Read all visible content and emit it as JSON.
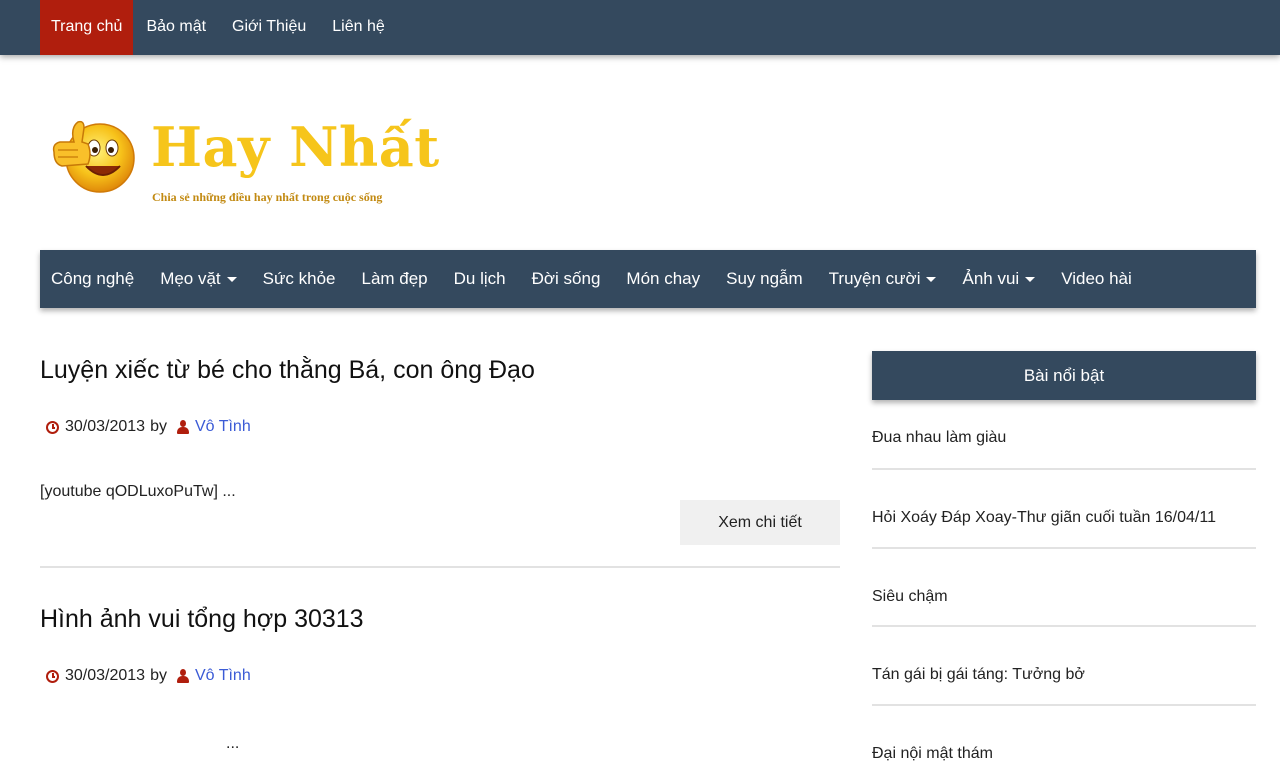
{
  "topnav": {
    "items": [
      "Trang chủ",
      "Bảo mật",
      "Giới Thiệu",
      "Liên hệ"
    ],
    "active_index": 0
  },
  "logo": {
    "title": "Hay Nhất",
    "tagline": "Chia sẻ những điều hay nhất trong cuộc sống",
    "icon": "thumbs-up-smiley-icon"
  },
  "mainnav": {
    "items": [
      {
        "label": "Công nghệ",
        "dropdown": false
      },
      {
        "label": "Mẹo vặt",
        "dropdown": true
      },
      {
        "label": "Sức khỏe",
        "dropdown": false
      },
      {
        "label": "Làm đẹp",
        "dropdown": false
      },
      {
        "label": "Du lịch",
        "dropdown": false
      },
      {
        "label": "Đời sống",
        "dropdown": false
      },
      {
        "label": "Món chay",
        "dropdown": false
      },
      {
        "label": "Suy ngẫm",
        "dropdown": false
      },
      {
        "label": "Truyện cười",
        "dropdown": true
      },
      {
        "label": "Ảnh vui",
        "dropdown": true
      },
      {
        "label": "Video hài",
        "dropdown": false
      }
    ]
  },
  "posts": [
    {
      "title": "Luyện xiếc từ bé cho thằng Bá, con ông Đạo",
      "date": "30/03/2013",
      "by": "by",
      "author": "Vô Tình",
      "excerpt": "[youtube qODLuxoPuTw] ...",
      "readmore": "Xem chi tiết"
    },
    {
      "title": "Hình ảnh vui tổng hợp 30313",
      "date": "30/03/2013",
      "by": "by",
      "author": "Vô Tình",
      "excerpt": "..."
    }
  ],
  "sidebar": {
    "title": "Bài nổi bật",
    "items": [
      "Đua nhau làm giàu",
      "Hỏi Xoáy Đáp Xoay-Thư giãn cuối tuần 16/04/11",
      "Siêu chậm",
      "Tán gái bị gái táng: Tưởng bở",
      "Đại nội mật thám"
    ]
  },
  "colors": {
    "nav_bg": "#34495e",
    "active_bg": "#b01e0d",
    "icon_red": "#b01e0d",
    "link_blue": "#3b5bd6",
    "logo_yellow": "#f6c51b"
  }
}
